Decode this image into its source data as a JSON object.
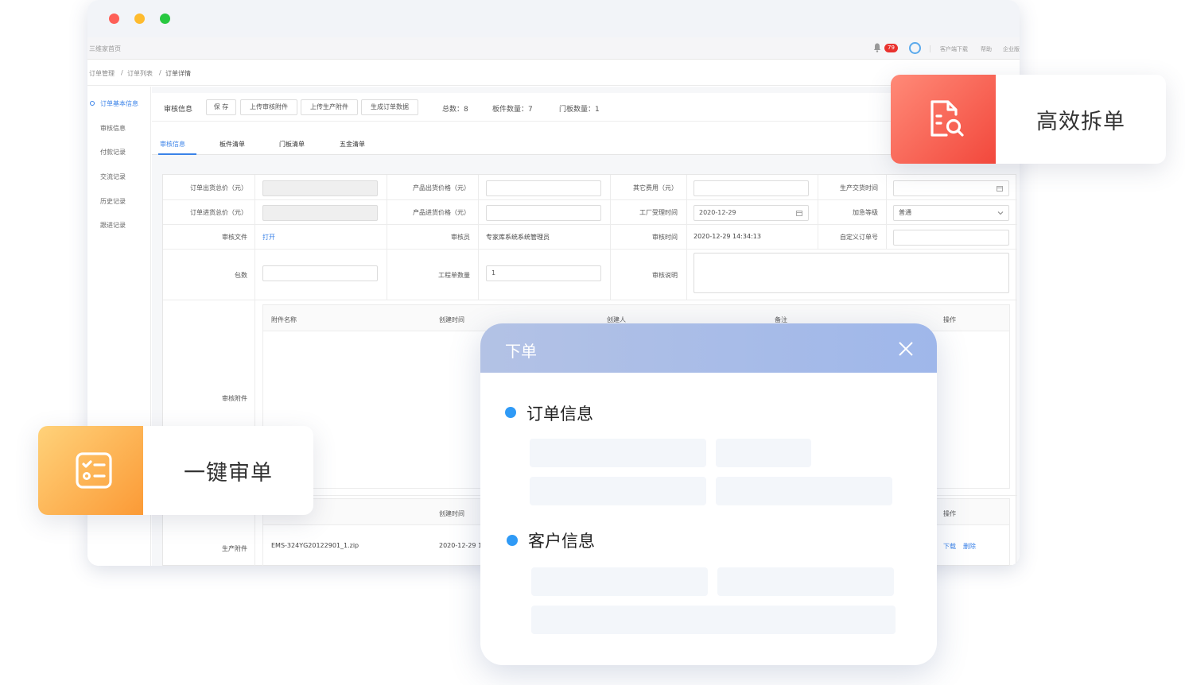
{
  "window": {
    "brand": "三维家首页",
    "notification_count": "79",
    "links": [
      "客户端下载",
      "帮助",
      "企业版"
    ]
  },
  "breadcrumb": [
    "订单管理",
    "订单列表",
    "订单详情"
  ],
  "sidebar": {
    "items": [
      "订单基本信息",
      "审核信息",
      "付款记录",
      "交流记录",
      "历史记录",
      "跟进记录"
    ]
  },
  "toolbar": {
    "title": "审核信息",
    "buttons": [
      "保 存",
      "上传审核附件",
      "上传生产附件",
      "生成订单数据"
    ],
    "stats": [
      "总数：8",
      "板件数量：7",
      "门板数量：1"
    ]
  },
  "tabs": [
    "审核信息",
    "板件清单",
    "门板清单",
    "五金清单"
  ],
  "form": {
    "order_out_total": "订单出货总价（元）",
    "product_out_price": "产品出货价格（元）",
    "other_fee": "其它费用（元）",
    "production_time": "生产交货时间",
    "order_in_total": "订单进货总价（元）",
    "product_in_price": "产品进货价格（元）",
    "factory_time": "工厂受理时间",
    "factory_time_value": "2020-12-29",
    "urgency": "加急等级",
    "urgency_value": "普通",
    "audit_file": "审核文件",
    "audit_file_link": "打开",
    "auditor": "审核员",
    "auditor_value": "专家库系统系统管理员",
    "audit_time": "审核时间",
    "audit_time_value": "2020-12-29 14:34:13",
    "custom_no": "自定义订单号",
    "packages": "包数",
    "work_order_count": "工程单数量",
    "work_order_count_value": "1",
    "audit_note": "审核说明",
    "audit_attachment": "审核附件",
    "attachment_headers": [
      "附件名称",
      "创建时间",
      "创建人",
      "备注",
      "操作"
    ],
    "production_attachment": "生产附件",
    "prod_headers": [
      "创建时间",
      "操作"
    ],
    "prod_file": "EMS-324YG20122901_1.zip",
    "prod_time": "2020-12-29 1",
    "prod_actions": [
      "下载",
      "删除"
    ]
  },
  "features": {
    "split": "高效拆单",
    "audit": "一键审单"
  },
  "dialog": {
    "title": "下单",
    "section_order": "订单信息",
    "section_customer": "客户信息"
  },
  "colors": {
    "accent": "#3a82e8",
    "split_gradient": [
      "#ff8a78",
      "#f2483c"
    ],
    "audit_gradient": [
      "#ffd27a",
      "#fb9a36"
    ],
    "dialog_header": "#a9bde8",
    "section_dot": "#2f9af6"
  }
}
